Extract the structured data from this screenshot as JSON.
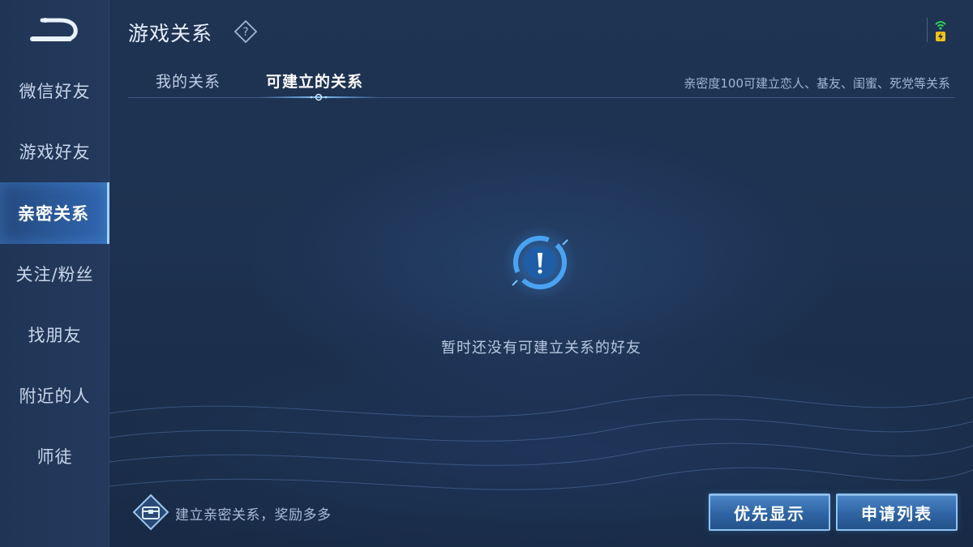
{
  "header": {
    "title": "游戏关系"
  },
  "sidebar": {
    "items": [
      {
        "label": "微信好友",
        "active": false
      },
      {
        "label": "游戏好友",
        "active": false
      },
      {
        "label": "亲密关系",
        "active": true
      },
      {
        "label": "关注/粉丝",
        "active": false
      },
      {
        "label": "找朋友",
        "active": false
      },
      {
        "label": "附近的人",
        "active": false
      },
      {
        "label": "师徒",
        "active": false
      }
    ]
  },
  "tabs": [
    {
      "label": "我的关系",
      "active": false
    },
    {
      "label": "可建立的关系",
      "active": true
    }
  ],
  "hint": "亲密度100可建立恋人、基友、闺蜜、死党等关系",
  "empty_state": {
    "message": "暂时还没有可建立关系的好友",
    "icon": "exclamation-icon"
  },
  "footer": {
    "reward_text": "建立亲密关系，奖励多多",
    "reward_icon": "treasure-chest-icon",
    "buttons": {
      "priority": "优先显示",
      "apply_list": "申请列表"
    }
  },
  "colors": {
    "accent": "#8cc4f3",
    "background": "#1d3150",
    "active_tab": "#ffffff"
  }
}
